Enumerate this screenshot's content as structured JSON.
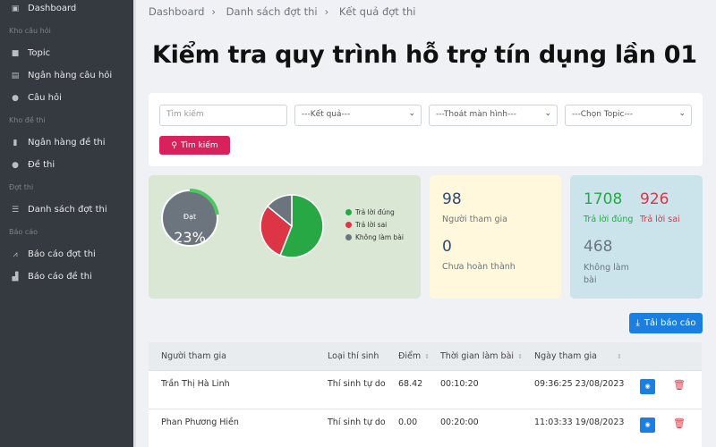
{
  "sidebar": {
    "items": [
      {
        "type": "item",
        "label": "Dashboard",
        "icon": "dashboard-icon"
      },
      {
        "type": "head",
        "label": "Kho câu hỏi"
      },
      {
        "type": "item",
        "label": "Topic",
        "icon": "folder-icon"
      },
      {
        "type": "item",
        "label": "Ngân hàng câu hỏi",
        "icon": "book-icon"
      },
      {
        "type": "item",
        "label": "Câu hỏi",
        "icon": "question-icon"
      },
      {
        "type": "head",
        "label": "Kho đề thi"
      },
      {
        "type": "item",
        "label": "Ngân hàng đề thi",
        "icon": "clipboard-icon"
      },
      {
        "type": "item",
        "label": "Đề thi",
        "icon": "check-circle-icon"
      },
      {
        "type": "head",
        "label": "Đợt thi"
      },
      {
        "type": "item",
        "label": "Danh sách đợt thi",
        "icon": "list-icon"
      },
      {
        "type": "head",
        "label": "Báo cáo"
      },
      {
        "type": "item",
        "label": "Báo cáo đợt thi",
        "icon": "line-chart-icon"
      },
      {
        "type": "item",
        "label": "Báo cáo đề thi",
        "icon": "bar-chart-icon"
      }
    ]
  },
  "breadcrumb": [
    "Dashboard",
    "Danh sách đợt thi",
    "Kết quả đợt thi"
  ],
  "title": "Kiểm tra quy trình hỗ trợ tín dụng lần 01",
  "filters": {
    "search_placeholder": "Tìm kiếm",
    "result": "---Kết quả---",
    "exit": "---Thoát màn hình---",
    "topic": "---Chọn Topic---",
    "search_button": "Tìm kiếm"
  },
  "gauge": {
    "label": "Đạt",
    "value_text": "23%",
    "percent": 23
  },
  "chart_data": {
    "type": "pie",
    "labels": [
      "Trả lời đúng",
      "Trả lời sai",
      "Không làm bài"
    ],
    "values": [
      56,
      30,
      14
    ],
    "colors": [
      "#28a745",
      "#dc3545",
      "#6c757d"
    ]
  },
  "stats": {
    "participants": "98",
    "participants_label": "Người tham gia",
    "incomplete": "0",
    "incomplete_label": "Chưa hoàn thành",
    "correct": "1708",
    "correct_label": "Trả lời đúng",
    "wrong": "926",
    "wrong_label": "Trả lời sai",
    "skipped": "468",
    "skipped_label": "Không làm bài"
  },
  "download_button": "Tải báo cáo",
  "table": {
    "headers": [
      "Người tham gia",
      "Loại thí sinh",
      "Điểm",
      "Thời gian làm bài",
      "Ngày tham gia"
    ],
    "rows": [
      [
        "Trần Thị Hà Linh",
        "Thí sinh tự do",
        "68.42",
        "00:10:20",
        "09:36:25 23/08/2023"
      ],
      [
        "Phan Phương Hiền",
        "Thí sinh tự do",
        "0.00",
        "00:20:00",
        "11:03:33 19/08/2023"
      ]
    ]
  }
}
